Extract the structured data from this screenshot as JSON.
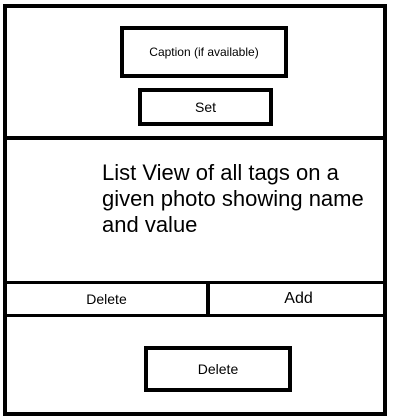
{
  "caption": {
    "label": "Caption (if available)"
  },
  "set_button": {
    "label": "Set"
  },
  "tag_list": {
    "description": "List View of all tags on a given photo showing name and value"
  },
  "row_actions": {
    "delete_label": "Delete",
    "add_label": "Add"
  },
  "bottom_action": {
    "delete_label": "Delete"
  }
}
